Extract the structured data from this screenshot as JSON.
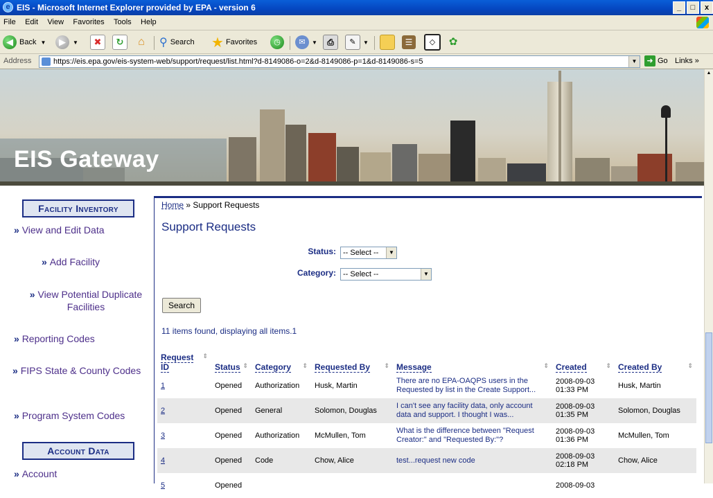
{
  "window": {
    "title": "EIS - Microsoft Internet Explorer provided by EPA - version 6",
    "controls": [
      "_",
      "□",
      "x"
    ]
  },
  "menu": [
    "File",
    "Edit",
    "View",
    "Favorites",
    "Tools",
    "Help"
  ],
  "toolbar": {
    "back_label": "Back",
    "search_label": "Search",
    "favorites_label": "Favorites"
  },
  "address": {
    "label": "Address",
    "url": "https://eis.epa.gov/eis-system-web/support/request/list.html?d-8149086-o=2&d-8149086-p=1&d-8149086-s=5",
    "go_label": "Go",
    "links_label": "Links »"
  },
  "banner": {
    "title": "EIS Gateway"
  },
  "sidebar": {
    "facility_header": "Facility Inventory",
    "facility_links": [
      "View and Edit Data",
      "Add Facility",
      "View Potential Duplicate Facilities",
      "Reporting Codes",
      "FIPS State & County Codes",
      "Program System Codes"
    ],
    "account_header": "Account Data",
    "account_links": [
      "Account"
    ]
  },
  "breadcrumb": {
    "home": "Home",
    "sep": " » ",
    "current": "Support Requests"
  },
  "page_title": "Support Requests",
  "filters": {
    "status_label": "Status:",
    "status_value": "-- Select --",
    "category_label": "Category:",
    "category_value": "-- Select --",
    "search_button": "Search"
  },
  "result_count": "11 items found, displaying all items.1",
  "table": {
    "columns": [
      "Request ID",
      "Status",
      "Category",
      "Requested By",
      "Message",
      "Created",
      "Created By"
    ],
    "rows": [
      {
        "id": "1",
        "status": "Opened",
        "category": "Authorization",
        "requested_by": "Husk, Martin",
        "message": "There are no EPA-OAQPS users in the Requested by list in the Create Support...",
        "created_date": "2008-09-03",
        "created_time": "01:33 PM",
        "created_by": "Husk, Martin"
      },
      {
        "id": "2",
        "status": "Opened",
        "category": "General",
        "requested_by": "Solomon, Douglas",
        "message": "I can't see any facility data, only account data and support. I thought I was...",
        "created_date": "2008-09-03",
        "created_time": "01:35 PM",
        "created_by": "Solomon, Douglas"
      },
      {
        "id": "3",
        "status": "Opened",
        "category": "Authorization",
        "requested_by": "McMullen, Tom",
        "message": "What is the difference between \"Request Creator:\" and \"Requested By:\"?",
        "created_date": "2008-09-03",
        "created_time": "01:36 PM",
        "created_by": "McMullen, Tom"
      },
      {
        "id": "4",
        "status": "Opened",
        "category": "Code",
        "requested_by": "Chow, Alice",
        "message": "test...request new code",
        "created_date": "2008-09-03",
        "created_time": "02:18 PM",
        "created_by": "Chow, Alice"
      },
      {
        "id": "5",
        "status": "Opened",
        "category": "",
        "requested_by": "",
        "message": "",
        "created_date": "2008-09-03",
        "created_time": "",
        "created_by": ""
      }
    ]
  }
}
